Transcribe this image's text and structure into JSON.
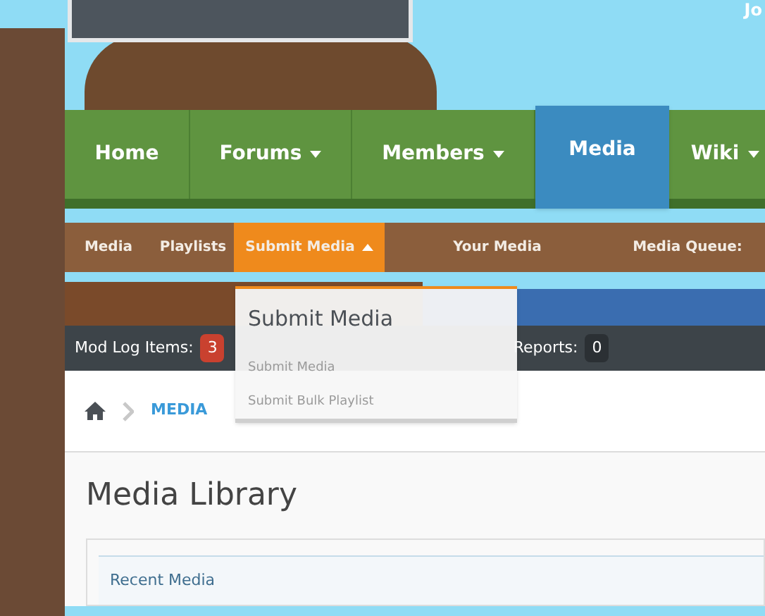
{
  "header": {
    "user_text": "Jo"
  },
  "nav": [
    {
      "label": "Home",
      "dropdown": false,
      "selected": false
    },
    {
      "label": "Forums",
      "dropdown": true,
      "selected": false
    },
    {
      "label": "Members",
      "dropdown": true,
      "selected": false
    },
    {
      "label": "Media",
      "dropdown": false,
      "selected": true
    },
    {
      "label": "Wiki",
      "dropdown": true,
      "selected": false
    }
  ],
  "subnav": [
    {
      "label": "Media",
      "selected": false,
      "dropdown": false
    },
    {
      "label": "Playlists",
      "selected": false,
      "dropdown": false
    },
    {
      "label": "Submit Media",
      "selected": true,
      "dropdown": true
    },
    {
      "label": "Your Media",
      "selected": false,
      "dropdown": false
    },
    {
      "label": "Media Queue:",
      "selected": false,
      "dropdown": false
    }
  ],
  "dropdown": {
    "title": "Submit Media",
    "items": [
      "Submit Media",
      "Submit Bulk Playlist"
    ]
  },
  "mod_bar": [
    {
      "label": "Mod Log Items:",
      "count": "3",
      "alert": true
    },
    {
      "label": "Reports:",
      "count": "0",
      "alert": false
    }
  ],
  "breadcrumb": [
    "MEDIA"
  ],
  "page_title": "Media Library",
  "tabs": [
    {
      "label": "Recent Media"
    }
  ]
}
